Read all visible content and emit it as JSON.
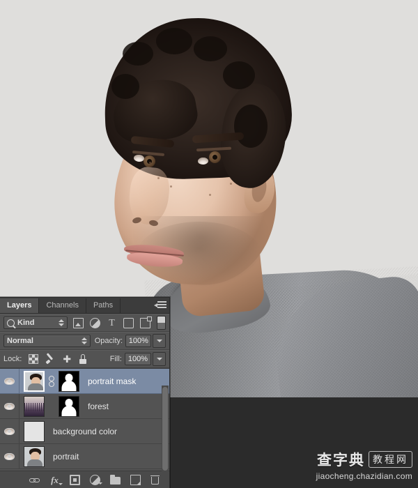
{
  "app": {
    "photo_alt": "portrait of young man with dark curly hair, gray shirt"
  },
  "panel": {
    "tabs": [
      {
        "label": "Layers",
        "active": true
      },
      {
        "label": "Channels",
        "active": false
      },
      {
        "label": "Paths",
        "active": false
      }
    ],
    "menu_icon": "panel-menu-icon",
    "filter": {
      "search_icon": "search-icon",
      "kind_label": "Kind",
      "icons": [
        "pixel-filter-icon",
        "adjustment-filter-icon",
        "type-filter-icon",
        "shape-filter-icon",
        "smart-object-filter-icon"
      ],
      "toggle": "filter-toggle-switch"
    },
    "blend": {
      "mode": "Normal",
      "opacity_label": "Opacity:",
      "opacity_value": "100%"
    },
    "lock": {
      "label": "Lock:",
      "icons": [
        "lock-transparent-pixels-icon",
        "lock-image-pixels-icon",
        "lock-position-icon",
        "lock-all-icon"
      ],
      "fill_label": "Fill:",
      "fill_value": "100%"
    },
    "layers": [
      {
        "name": "portrait mask",
        "visible": true,
        "selected": true,
        "has_mask": true,
        "linked": true,
        "thumb_type": "portrait"
      },
      {
        "name": "forest",
        "visible": true,
        "selected": false,
        "has_mask": true,
        "linked": false,
        "thumb_type": "forest"
      },
      {
        "name": "background color",
        "visible": true,
        "selected": false,
        "has_mask": false,
        "linked": false,
        "thumb_type": "solid"
      },
      {
        "name": "portrait",
        "visible": true,
        "selected": false,
        "has_mask": false,
        "linked": false,
        "thumb_type": "portrait"
      }
    ],
    "footer_buttons": [
      "link-layers-icon",
      "layer-style-fx-icon",
      "add-layer-mask-icon",
      "new-adjustment-layer-icon",
      "new-group-icon",
      "new-layer-icon",
      "delete-layer-icon"
    ]
  },
  "watermark": {
    "brand_cn": "查字典",
    "brand_box": "教程网",
    "url": "jiaocheng.chazidian.com"
  },
  "colors": {
    "panel_bg": "#535353",
    "panel_header": "#3c3c3c",
    "selection": "#7b8ba4",
    "canvas_bg": "#dedede",
    "dark_band": "#2b2b2b"
  }
}
